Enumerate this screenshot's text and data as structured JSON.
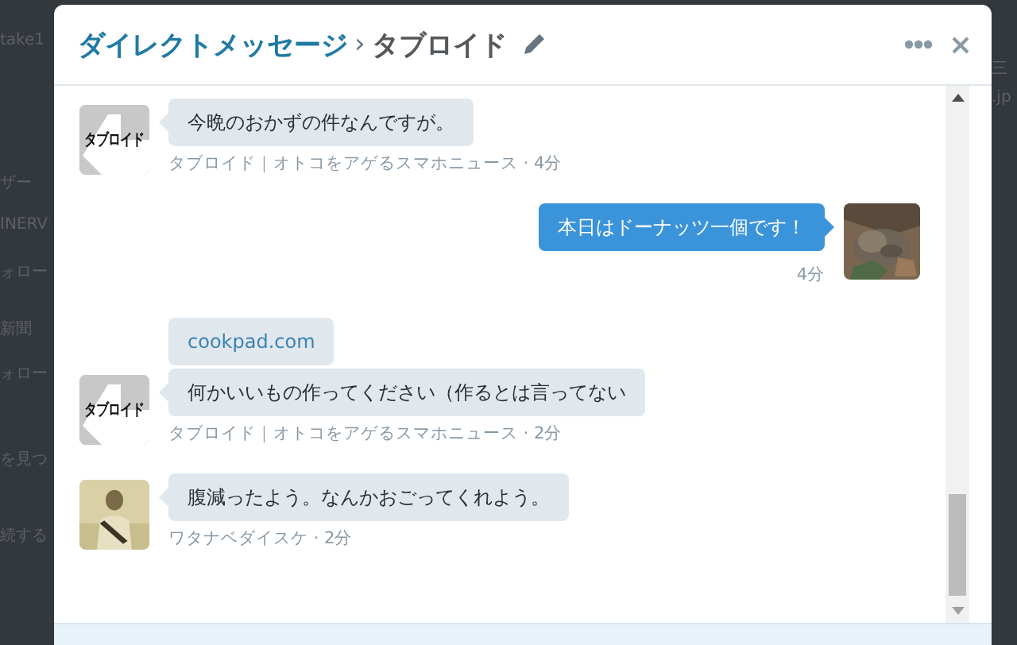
{
  "background_fragments": {
    "left": [
      "take1",
      "ザー",
      "INERV",
      "ォロー",
      "新聞",
      "ォロー",
      "を見つ",
      "続する"
    ],
    "right": [
      "三",
      ".jp"
    ]
  },
  "dialog": {
    "title": "ダイレクトメッセージ",
    "separator": "›",
    "conversation": "タブロイド"
  },
  "messages": [
    {
      "kind": "incoming",
      "avatar": {
        "kind": "logo",
        "label": "タブロイド"
      },
      "bubbles": [
        {
          "kind": "text",
          "text": "今晩のおかずの件なんですが。"
        }
      ],
      "meta": "タブロイド｜オトコをアゲるスマホニュース · 4分"
    },
    {
      "kind": "outgoing",
      "avatar": {
        "kind": "picture"
      },
      "bubbles": [
        {
          "kind": "text",
          "text": "本日はドーナッツ一個です！"
        }
      ],
      "meta": "4分"
    },
    {
      "kind": "incoming",
      "avatar": {
        "kind": "logo",
        "label": "タブロイド"
      },
      "bubbles": [
        {
          "kind": "link",
          "text": "cookpad.com"
        },
        {
          "kind": "text",
          "text": "何かいいもの作ってください（作るとは言ってない"
        }
      ],
      "meta": "タブロイド｜オトコをアゲるスマホニュース · 2分"
    },
    {
      "kind": "incoming",
      "avatar": {
        "kind": "person"
      },
      "bubbles": [
        {
          "kind": "text",
          "text": "腹減ったよう。なんかおごってくれよう。"
        }
      ],
      "meta": "ワタナベダイスケ · 2分"
    }
  ]
}
